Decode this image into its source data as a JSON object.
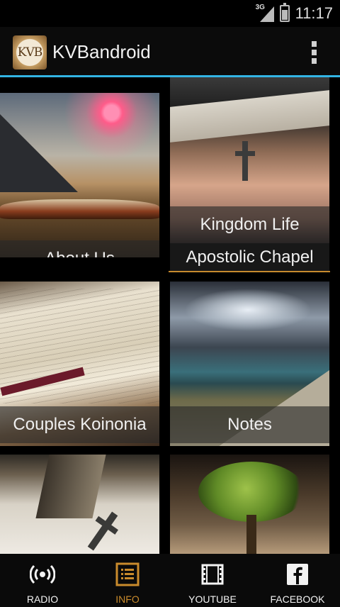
{
  "status_bar": {
    "network": "3G",
    "time": "11:17"
  },
  "app": {
    "title": "KVBandroid",
    "logo_text": "KVB"
  },
  "tiles": [
    {
      "label": "About Us"
    },
    {
      "label": "Kingdom Life"
    },
    {
      "label": "Couples Koinonia"
    },
    {
      "label": "Notes"
    },
    {
      "label": ""
    },
    {
      "label": ""
    }
  ],
  "partial_item": {
    "label": "Apostolic Chapel"
  },
  "bottom_nav": [
    {
      "label": "RADIO",
      "icon": "radio-broadcast-icon",
      "active": false
    },
    {
      "label": "INFO",
      "icon": "list-icon",
      "active": true
    },
    {
      "label": "YOUTUBE",
      "icon": "film-icon",
      "active": false
    },
    {
      "label": "FACEBOOK",
      "icon": "facebook-icon",
      "active": false
    }
  ],
  "colors": {
    "accent_blue": "#33b5e5",
    "active_orange": "#c98b2c",
    "background": "#000000"
  }
}
